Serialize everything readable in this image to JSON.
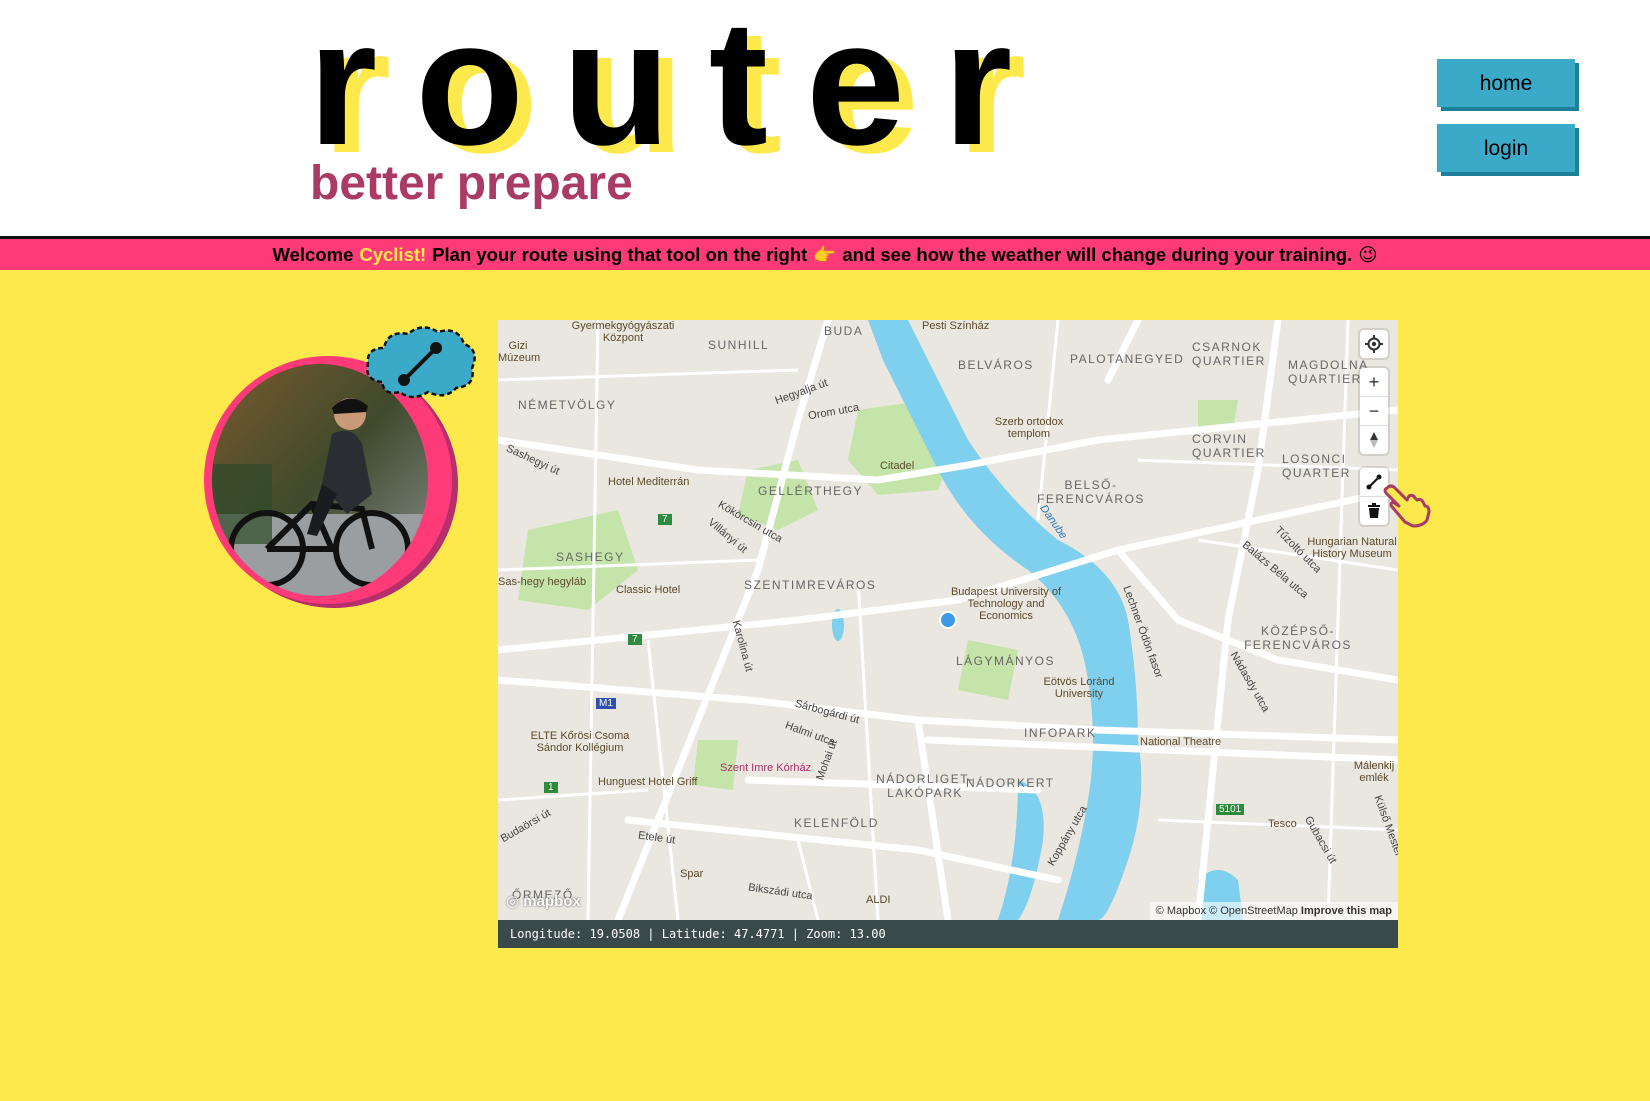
{
  "header": {
    "logo_text": "router",
    "tagline": "better prepare",
    "nav": {
      "home_label": "home",
      "login_label": "login"
    }
  },
  "banner": {
    "welcome": "Welcome",
    "role": "Cyclist!",
    "message": "Plan your route using that tool on the right",
    "pointer_emoji": "👉",
    "message_end": "and see how the weather will change during your training.",
    "wink_emoji": "😉"
  },
  "colors": {
    "background": "#fde94c",
    "banner": "#ff3a79",
    "tagline": "#a93b64",
    "button": "#3aaac8",
    "water": "#7fcfee",
    "park": "#bfe3a3"
  },
  "map": {
    "districts": [
      "SUNHILL",
      "BUDA",
      "BELVÁROS",
      "PALOTANEGYED",
      "CSARNOK QUARTIER",
      "MAGDOLNA QUARTIER",
      "NÉMETVÖLGY",
      "GELLÉRTHEGY",
      "BELSŐ-FERENCVÁROS",
      "CORVIN QUARTIER",
      "LOSONCI QUARTER",
      "SASHEGY",
      "SZENTIMREVÁROS",
      "KÖZÉPSŐ-FERENCVÁROS",
      "LÁGYMÁNYOS",
      "INFOPARK",
      "NÁDORLIGET-LAKÓPARK",
      "NÁDORKERT",
      "KELENFÖLD",
      "ŐRMEZŐ"
    ],
    "places": [
      "Gyermekgyógyászati Központ",
      "Pesti Színház",
      "Gizi Múzeum",
      "Szerb ortodox templom",
      "Hotel Mediterrán",
      "Citadel",
      "Hungarian Natural History Museum",
      "Sas-hegy hegyláb",
      "Classic Hotel",
      "Budapest University of Technology and Economics",
      "Eötvös Loránd University",
      "ELTE Kőrösi Csoma Sándor Kollégium",
      "National Theatre",
      "Szent Imre Kórház",
      "Hunguest Hotel Griff",
      "Tesco",
      "Málenkij emlék",
      "Spar",
      "ALDI",
      "Danube"
    ],
    "streets": [
      "Hegyalja út",
      "Orom utca",
      "Sashegyi út",
      "Kökörcsin utca",
      "Villányi út",
      "Karolina út",
      "Sárbogárdi út",
      "Halmi utca",
      "Mohai út",
      "Etele út",
      "Bikszádi utca",
      "Budaörsi út",
      "Lechner Ödön fasor",
      "Nádasdy utca",
      "Balázs Béla utca",
      "Tűzoltó utca",
      "Gubacsi út",
      "Koppány utca",
      "Külső Mester"
    ],
    "route_badges": [
      "7",
      "7",
      "M1",
      "1",
      "5101"
    ],
    "controls": {
      "geolocate": "geolocate-icon",
      "zoom_in": "+",
      "zoom_out": "−",
      "compass": "compass-icon",
      "draw_line": "line-draw-icon",
      "trash": "trash-icon"
    },
    "attribution": {
      "mapbox": "© Mapbox",
      "osm": "© OpenStreetMap",
      "improve": "Improve this map"
    },
    "logo": "mapbox"
  },
  "coords": {
    "text": "Longitude: 19.0508 | Latitude: 47.4771 | Zoom: 13.00"
  }
}
